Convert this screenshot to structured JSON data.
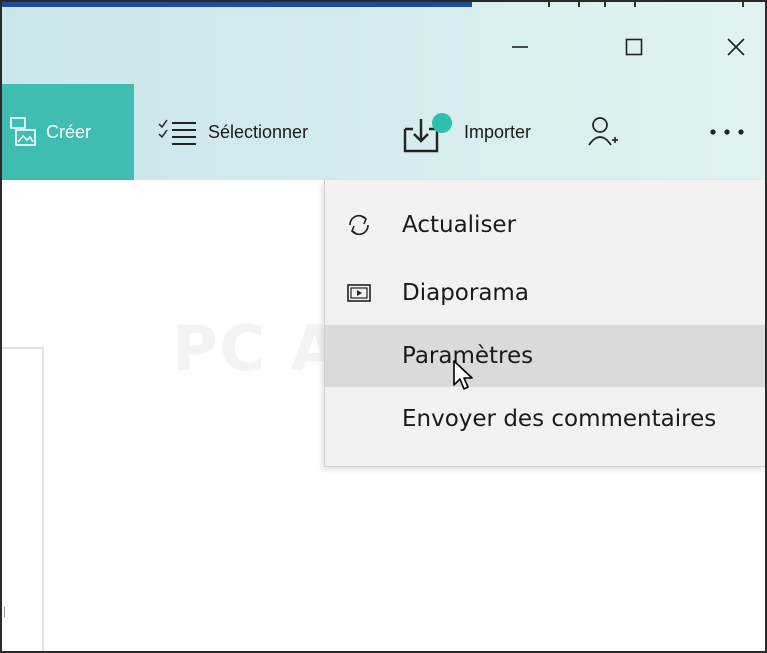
{
  "window_controls": {
    "minimize_icon": "minimize-icon",
    "maximize_icon": "maximize-icon",
    "close_icon": "close-icon"
  },
  "command_bar": {
    "create_label": "Créer",
    "select_label": "Sélectionner",
    "import_label": "Importer",
    "add_person_icon": "add-person-icon",
    "more_icon": "more-icon"
  },
  "menu": {
    "items": [
      {
        "label": "Actualiser",
        "icon": "refresh-icon"
      },
      {
        "label": "Diaporama",
        "icon": "slideshow-icon"
      },
      {
        "label": "Paramètres",
        "icon": ""
      },
      {
        "label": "Envoyer des commentaires",
        "icon": ""
      }
    ],
    "hovered_index": 2
  },
  "colors": {
    "accent": "#3fbdb0",
    "titlebar": "#d3eaed",
    "menu_bg": "#f2f2f2",
    "menu_hover": "#dadada",
    "badge": "#2fbfb0"
  }
}
